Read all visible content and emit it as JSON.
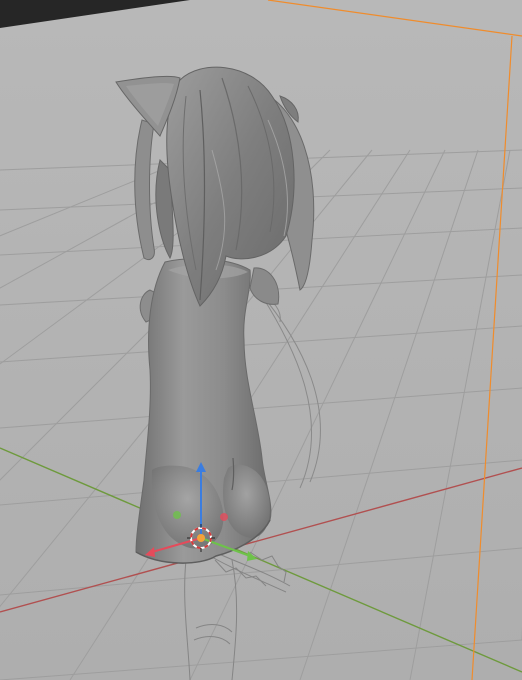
{
  "app": {
    "window_title": "",
    "viewport_mode": "Solid"
  },
  "viewport": {
    "background": "#b3b3b3",
    "grid_color": "#9c9c9c",
    "axis_x_color": "#b15050",
    "axis_y_color": "#6e9a3d",
    "camera_frame_color": "#f08c2c",
    "mesh_color": "#8b8b8b",
    "selection_outline_color": "#f4a23a"
  },
  "scene": {
    "active_object": "character-body",
    "objects": [
      {
        "name": "character-body",
        "visible": true,
        "shading": "solid"
      },
      {
        "name": "hair-strands",
        "visible": true,
        "shading": "solid"
      },
      {
        "name": "cat-ear",
        "visible": true,
        "shading": "solid"
      },
      {
        "name": "lower-body-wireframe",
        "visible": true,
        "shading": "wire"
      },
      {
        "name": "back-ribbon-wireframe",
        "visible": true,
        "shading": "wire"
      }
    ]
  },
  "gizmo": {
    "type": "translate",
    "axes": [
      {
        "axis": "x",
        "color": "#e54b5b"
      },
      {
        "axis": "y",
        "color": "#6ec24a"
      },
      {
        "axis": "z",
        "color": "#3b7de0"
      }
    ],
    "pivot_icon": "3d-cursor-icon"
  }
}
